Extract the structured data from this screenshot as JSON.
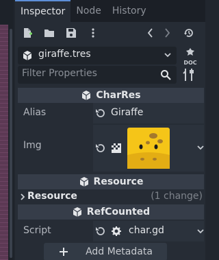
{
  "tabs": [
    {
      "label": "Inspector",
      "active": true
    },
    {
      "label": "Node",
      "active": false
    },
    {
      "label": "History",
      "active": false
    }
  ],
  "toolbar": {
    "icons": [
      "new-resource-icon",
      "open-folder-icon",
      "save-icon",
      "more-vertical-icon",
      "history-back-icon",
      "history-forward-icon",
      "object-history-icon"
    ]
  },
  "resource": {
    "name": "giraffe.tres",
    "doc_label": "DOC"
  },
  "filter": {
    "placeholder": "Filter Properties"
  },
  "sections": {
    "charres": {
      "title": "CharRes",
      "props": {
        "alias": {
          "label": "Alias",
          "value": "Giraffe"
        },
        "img": {
          "label": "Img"
        }
      }
    },
    "resource": {
      "title": "Resource",
      "group_label": "Resource",
      "change_note": "(1 change)"
    },
    "refcounted": {
      "title": "RefCounted",
      "script": {
        "label": "Script",
        "value": "char.gd"
      }
    }
  },
  "add_metadata": {
    "label": "Add Metadata"
  },
  "colors": {
    "accent": "#5d8fd8",
    "image_yellow": "#f5c518",
    "image_brown": "#a4792d"
  }
}
